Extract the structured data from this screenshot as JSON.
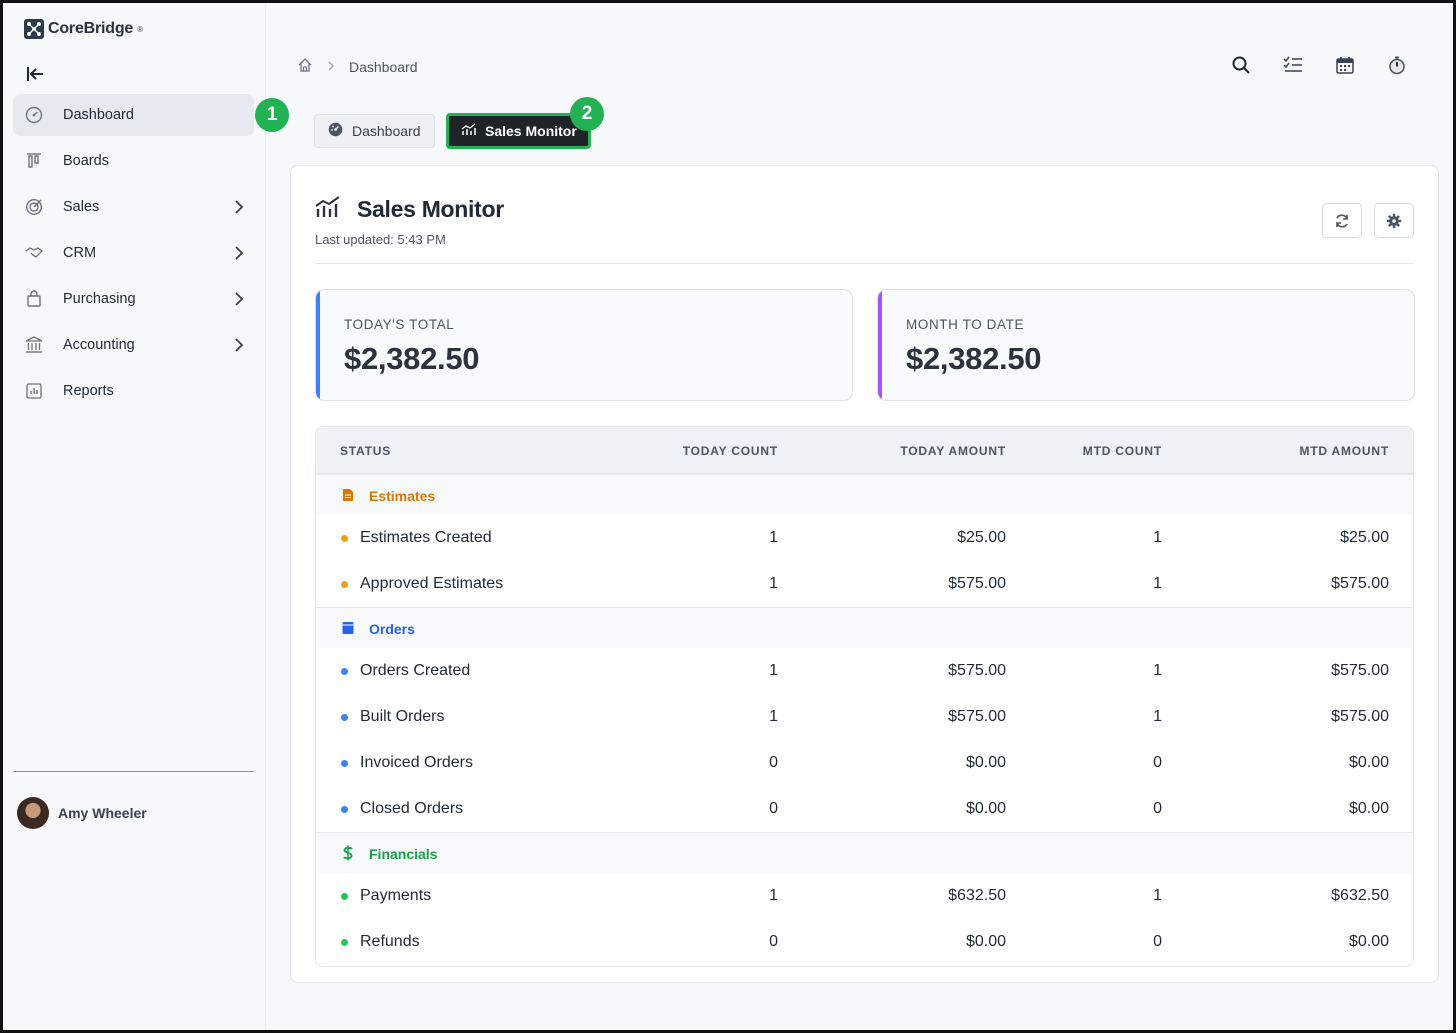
{
  "app": {
    "name": "CoreBridge",
    "reg": "®"
  },
  "sidebar": {
    "items": [
      {
        "label": "Dashboard",
        "icon": "dashboard-gauge-icon",
        "has_chevron": false,
        "active": true
      },
      {
        "label": "Boards",
        "icon": "boards-icon",
        "has_chevron": false
      },
      {
        "label": "Sales",
        "icon": "target-icon",
        "has_chevron": true
      },
      {
        "label": "CRM",
        "icon": "handshake-icon",
        "has_chevron": true
      },
      {
        "label": "Purchasing",
        "icon": "shopping-bag-icon",
        "has_chevron": true
      },
      {
        "label": "Accounting",
        "icon": "bank-icon",
        "has_chevron": true
      },
      {
        "label": "Reports",
        "icon": "report-chart-icon",
        "has_chevron": false
      }
    ],
    "user": {
      "name": "Amy Wheeler"
    }
  },
  "callouts": {
    "one": "1",
    "two": "2"
  },
  "breadcrumb": {
    "current": "Dashboard"
  },
  "tabs": [
    {
      "label": "Dashboard"
    },
    {
      "label": "Sales Monitor"
    }
  ],
  "card": {
    "title": "Sales Monitor",
    "last_updated": "Last updated: 5:43 PM"
  },
  "stats": {
    "today": {
      "label": "TODAY'S TOTAL",
      "value": "$2,382.50"
    },
    "mtd": {
      "label": "MONTH TO DATE",
      "value": "$2,382.50"
    }
  },
  "table": {
    "headers": {
      "status": "STATUS",
      "today_count": "TODAY COUNT",
      "today_amount": "TODAY AMOUNT",
      "mtd_count": "MTD COUNT",
      "mtd_amount": "MTD AMOUNT"
    },
    "groups": {
      "estimates": {
        "label": "Estimates",
        "color": "#d97706",
        "rows": [
          {
            "name": "Estimates Created",
            "today_count": "1",
            "today_amount": "$25.00",
            "mtd_count": "1",
            "mtd_amount": "$25.00"
          },
          {
            "name": "Approved Estimates",
            "today_count": "1",
            "today_amount": "$575.00",
            "mtd_count": "1",
            "mtd_amount": "$575.00"
          }
        ]
      },
      "orders": {
        "label": "Orders",
        "color": "#2563eb",
        "rows": [
          {
            "name": "Orders Created",
            "today_count": "1",
            "today_amount": "$575.00",
            "mtd_count": "1",
            "mtd_amount": "$575.00"
          },
          {
            "name": "Built Orders",
            "today_count": "1",
            "today_amount": "$575.00",
            "mtd_count": "1",
            "mtd_amount": "$575.00"
          },
          {
            "name": "Invoiced Orders",
            "today_count": "0",
            "today_amount": "$0.00",
            "mtd_count": "0",
            "mtd_amount": "$0.00"
          },
          {
            "name": "Closed Orders",
            "today_count": "0",
            "today_amount": "$0.00",
            "mtd_count": "0",
            "mtd_amount": "$0.00"
          }
        ]
      },
      "financials": {
        "label": "Financials",
        "color": "#16a34a",
        "rows": [
          {
            "name": "Payments",
            "today_count": "1",
            "today_amount": "$632.50",
            "mtd_count": "1",
            "mtd_amount": "$632.50"
          },
          {
            "name": "Refunds",
            "today_count": "0",
            "today_amount": "$0.00",
            "mtd_count": "0",
            "mtd_amount": "$0.00"
          }
        ]
      }
    }
  },
  "colors": {
    "accent_green": "#22b153",
    "estimates": "#f59e0b",
    "orders": "#3b82f6",
    "financials": "#22c55e"
  }
}
